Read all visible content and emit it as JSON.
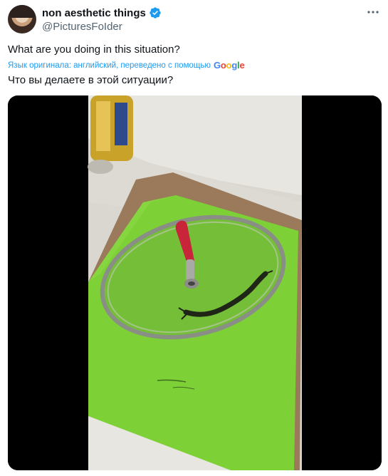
{
  "tweet": {
    "display_name": "non aesthetic things",
    "handle": "@PicturesFoIder",
    "text": "What are you doing in this situation?",
    "translation_note": "Язык оригинала: английский, переведено с помощью",
    "translation_provider": "Google",
    "translated_text": "Что вы делаете в этой ситуации?"
  },
  "icons": {
    "verified": "verified-badge-icon",
    "more": "more-options-icon"
  },
  "colors": {
    "link": "#1d9bf0",
    "secondary_text": "#536471",
    "primary_text": "#0f1419",
    "cutting_board": "#7dd136"
  }
}
